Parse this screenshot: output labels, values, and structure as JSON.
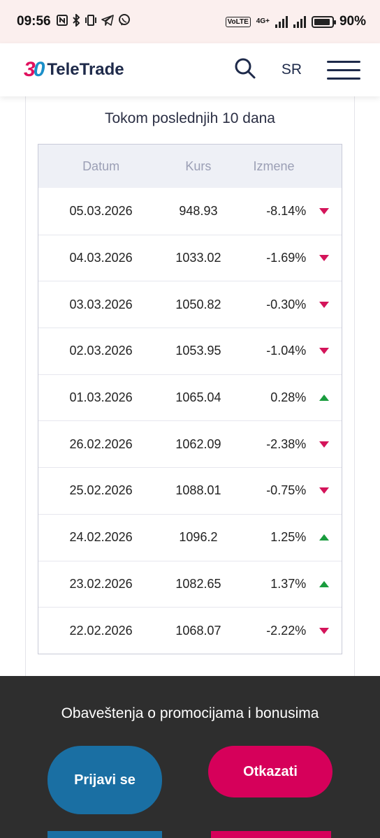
{
  "status_bar": {
    "time": "09:56",
    "icons": [
      "nfc-icon",
      "bluetooth-icon",
      "vibrate-icon",
      "telegram-icon",
      "viber-icon"
    ],
    "volte": "VoLTE",
    "network": "4G+",
    "battery_level": 0.9,
    "battery_text": "90%"
  },
  "header": {
    "logo_mark_3": "3",
    "logo_mark_0": "0",
    "logo_text": "TeleTrade",
    "language": "SR"
  },
  "section": {
    "title": "Tokom poslednjih 10 dana"
  },
  "table": {
    "headers": {
      "date": "Datum",
      "rate": "Kurs",
      "change": "Izmene"
    },
    "rows": [
      {
        "date": "05.03.2026",
        "rate": "948.93",
        "change": "-8.14%",
        "direction": "down"
      },
      {
        "date": "04.03.2026",
        "rate": "1033.02",
        "change": "-1.69%",
        "direction": "down"
      },
      {
        "date": "03.03.2026",
        "rate": "1050.82",
        "change": "-0.30%",
        "direction": "down"
      },
      {
        "date": "02.03.2026",
        "rate": "1053.95",
        "change": "-1.04%",
        "direction": "down"
      },
      {
        "date": "01.03.2026",
        "rate": "1065.04",
        "change": "0.28%",
        "direction": "up"
      },
      {
        "date": "26.02.2026",
        "rate": "1062.09",
        "change": "-2.38%",
        "direction": "down"
      },
      {
        "date": "25.02.2026",
        "rate": "1088.01",
        "change": "-0.75%",
        "direction": "down"
      },
      {
        "date": "24.02.2026",
        "rate": "1096.2",
        "change": "1.25%",
        "direction": "up"
      },
      {
        "date": "23.02.2026",
        "rate": "1082.65",
        "change": "1.37%",
        "direction": "up"
      },
      {
        "date": "22.02.2026",
        "rate": "1068.07",
        "change": "-2.22%",
        "direction": "down"
      }
    ]
  },
  "notification": {
    "text": "Obaveštenja o promocijama i bonusima",
    "login_label": "Prijavi se",
    "cancel_label": "Otkazati"
  },
  "colors": {
    "brand_pink": "#d6005a",
    "brand_blue": "#1a6fa3",
    "down": "#d4145a",
    "up": "#1a9c3e"
  }
}
